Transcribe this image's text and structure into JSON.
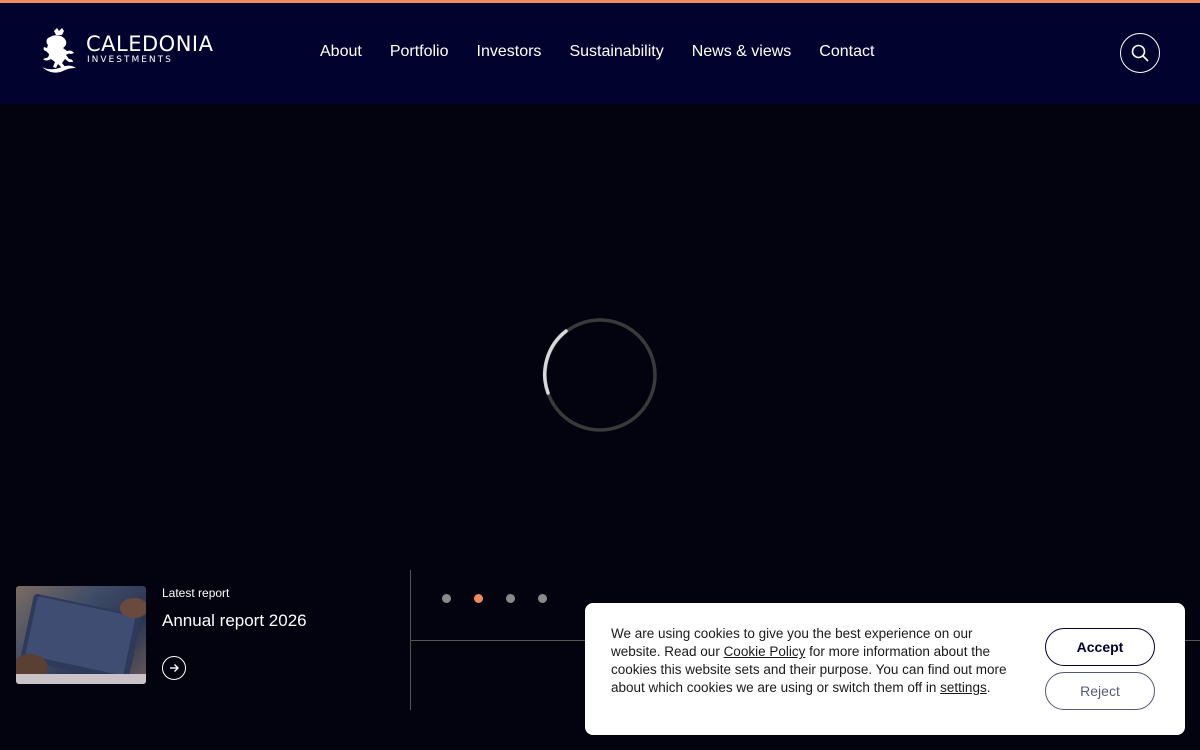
{
  "brand": {
    "name": "CALEDONIA",
    "subtitle": "INVESTMENTS",
    "logo_icon": "lion-crest-icon",
    "accent_color": "#f08a5d",
    "header_color": "#02022e"
  },
  "nav": {
    "items": [
      "About",
      "Portfolio",
      "Investors",
      "Sustainability",
      "News & views",
      "Contact"
    ]
  },
  "search": {
    "icon": "search-icon"
  },
  "loading": {
    "icon": "loading-spinner-icon"
  },
  "report": {
    "kicker": "Latest report",
    "title": "Annual report 2026",
    "arrow_icon": "arrow-right-icon"
  },
  "carousel": {
    "slide_count": 4,
    "active_index": 1
  },
  "cookie": {
    "text_before_link": "We are using cookies to give you the best experience on our website. Read our ",
    "policy_link": "Cookie Policy",
    "text_middle": " for more information about the cookies this website sets and their purpose. You can find out more about which cookies we are using or switch them off in ",
    "settings_link": "settings",
    "text_end": ".",
    "accept_label": "Accept",
    "reject_label": "Reject"
  }
}
